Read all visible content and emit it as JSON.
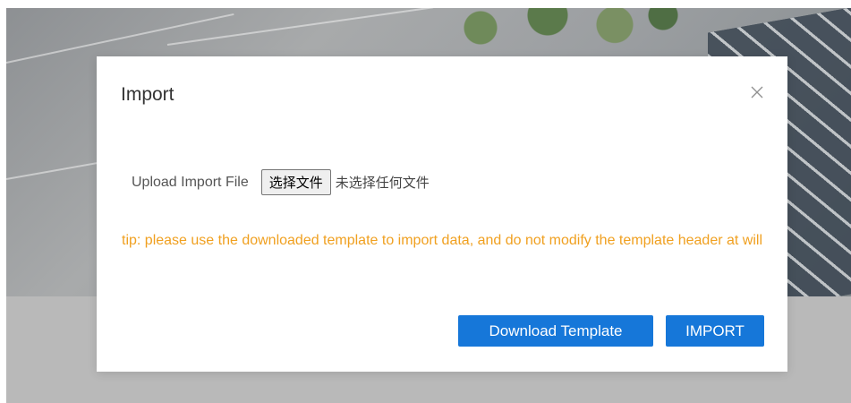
{
  "modal": {
    "title": "Import",
    "close_icon": "close-icon",
    "upload": {
      "label": "Upload Import File",
      "file_button": "选择文件",
      "file_status": "未选择任何文件"
    },
    "tip": "tip: please use the downloaded template to import data, and do not modify the template header at will",
    "buttons": {
      "download_template": "Download Template",
      "import": "IMPORT"
    }
  },
  "colors": {
    "primary": "#1677d9",
    "tip": "#f0a020",
    "overlay_gray": "#b9b9b9"
  }
}
